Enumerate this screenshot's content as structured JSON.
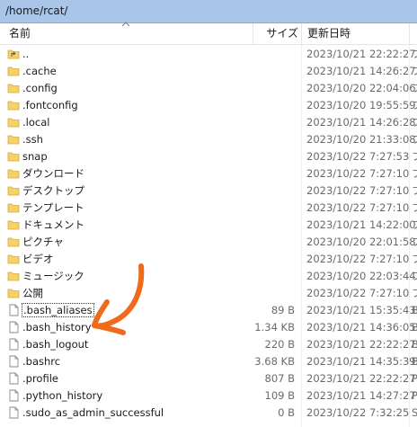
{
  "path": "/home/rcat/",
  "columns": {
    "name": "名前",
    "size": "サイズ",
    "modified": "更新日時"
  },
  "rows": [
    {
      "icon": "parent-folder-icon",
      "name": "..",
      "size": "",
      "modified": "2023/10/21 22:22:27",
      "type": "フ"
    },
    {
      "icon": "folder-icon",
      "name": ".cache",
      "size": "",
      "modified": "2023/10/21 14:26:27",
      "type": "フ"
    },
    {
      "icon": "folder-icon",
      "name": ".config",
      "size": "",
      "modified": "2023/10/20 22:04:06",
      "type": "フ"
    },
    {
      "icon": "folder-icon",
      "name": ".fontconfig",
      "size": "",
      "modified": "2023/10/20 19:55:59",
      "type": "フ"
    },
    {
      "icon": "folder-icon",
      "name": ".local",
      "size": "",
      "modified": "2023/10/21 14:26:28",
      "type": "フ"
    },
    {
      "icon": "folder-icon",
      "name": ".ssh",
      "size": "",
      "modified": "2023/10/20 21:33:08",
      "type": "フ"
    },
    {
      "icon": "folder-icon",
      "name": "snap",
      "size": "",
      "modified": "2023/10/22 7:27:53",
      "type": "フ"
    },
    {
      "icon": "folder-icon",
      "name": "ダウンロード",
      "size": "",
      "modified": "2023/10/22 7:27:10",
      "type": "フ"
    },
    {
      "icon": "folder-icon",
      "name": "デスクトップ",
      "size": "",
      "modified": "2023/10/22 7:27:10",
      "type": "フ"
    },
    {
      "icon": "folder-icon",
      "name": "テンプレート",
      "size": "",
      "modified": "2023/10/22 7:27:10",
      "type": "フ"
    },
    {
      "icon": "folder-icon",
      "name": "ドキュメント",
      "size": "",
      "modified": "2023/10/21 14:22:00",
      "type": "フ"
    },
    {
      "icon": "folder-icon",
      "name": "ピクチャ",
      "size": "",
      "modified": "2023/10/20 22:01:58",
      "type": "フ"
    },
    {
      "icon": "folder-icon",
      "name": "ビデオ",
      "size": "",
      "modified": "2023/10/22 7:27:10",
      "type": "フ"
    },
    {
      "icon": "folder-icon",
      "name": "ミュージック",
      "size": "",
      "modified": "2023/10/20 22:03:44",
      "type": "フ"
    },
    {
      "icon": "folder-icon",
      "name": "公開",
      "size": "",
      "modified": "2023/10/22 7:27:10",
      "type": "フ"
    },
    {
      "icon": "file-icon",
      "name": ".bash_aliases",
      "size": "89 B",
      "modified": "2023/10/21 15:35:43",
      "type": "B"
    },
    {
      "icon": "file-icon",
      "name": ".bash_history",
      "size": "1.34 KB",
      "modified": "2023/10/21 14:36:05",
      "type": "B"
    },
    {
      "icon": "file-icon",
      "name": ".bash_logout",
      "size": "220 B",
      "modified": "2023/10/21 22:22:27",
      "type": "B"
    },
    {
      "icon": "file-icon",
      "name": ".bashrc",
      "size": "3.68 KB",
      "modified": "2023/10/21 14:35:39",
      "type": "B"
    },
    {
      "icon": "file-icon",
      "name": ".profile",
      "size": "807 B",
      "modified": "2023/10/21 22:22:27",
      "type": "P"
    },
    {
      "icon": "file-icon",
      "name": ".python_history",
      "size": "109 B",
      "modified": "2023/10/21 14:27:27",
      "type": "P"
    },
    {
      "icon": "file-icon",
      "name": ".sudo_as_admin_successful",
      "size": "0 B",
      "modified": "2023/10/22 7:32:25",
      "type": "S"
    }
  ],
  "focused_row": 15,
  "colors": {
    "pathbar": "#a9c6e8",
    "folder": "#f6d16a",
    "annotation": "#f06a1c"
  }
}
